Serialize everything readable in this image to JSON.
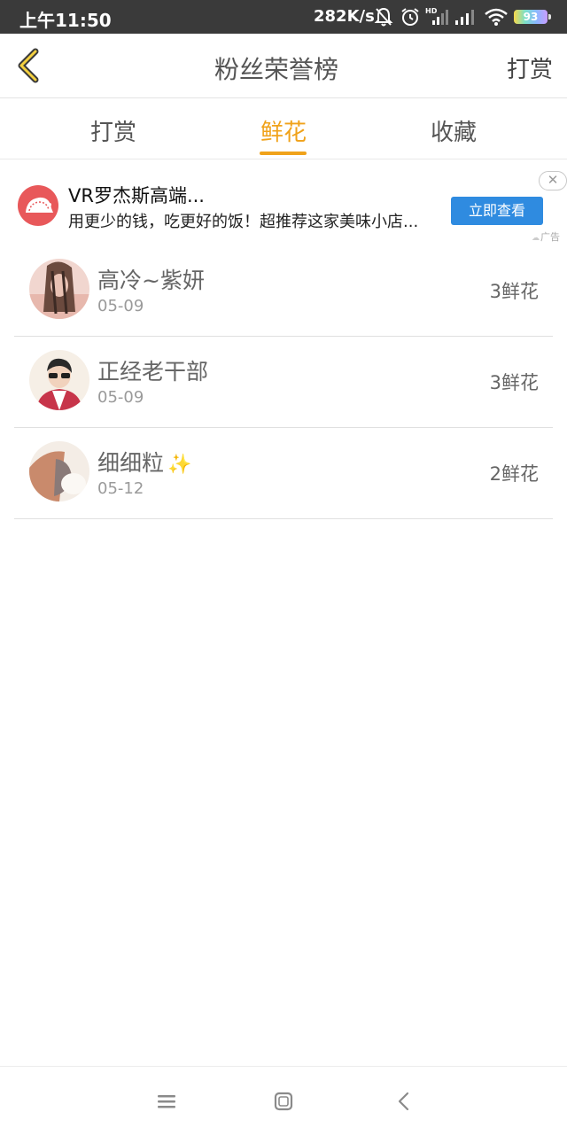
{
  "status": {
    "time": "上午11:50",
    "speed": "282K/s",
    "battery": "93",
    "icons": [
      "mute-bell-icon",
      "alarm-icon",
      "hd-signal-icon",
      "signal-icon",
      "wifi-icon",
      "battery-icon"
    ]
  },
  "header": {
    "title": "粉丝荣誉榜",
    "action_label": "打赏",
    "back_icon": "chevron-left-icon",
    "accent_color": "#f0a21a"
  },
  "tabs": [
    {
      "label": "打赏",
      "active": false
    },
    {
      "label": "鲜花",
      "active": true
    },
    {
      "label": "收藏",
      "active": false
    }
  ],
  "ad": {
    "title": "VR罗杰斯高端...",
    "description": "用更少的钱，吃更好的饭！超推荐这家美味小店...",
    "button_label": "立即查看",
    "tag": "广告",
    "close_label": "✕"
  },
  "fans": [
    {
      "name": "高冷~紫妍",
      "date": "05-09",
      "count": "3鲜花",
      "emoji": ""
    },
    {
      "name": "正经老干部",
      "date": "05-09",
      "count": "3鲜花",
      "emoji": ""
    },
    {
      "name": "细细粒",
      "date": "05-12",
      "count": "2鲜花",
      "emoji": "✨"
    }
  ],
  "navbar": {
    "icons": [
      "menu-icon",
      "home-square-icon",
      "back-triangle-icon"
    ]
  }
}
